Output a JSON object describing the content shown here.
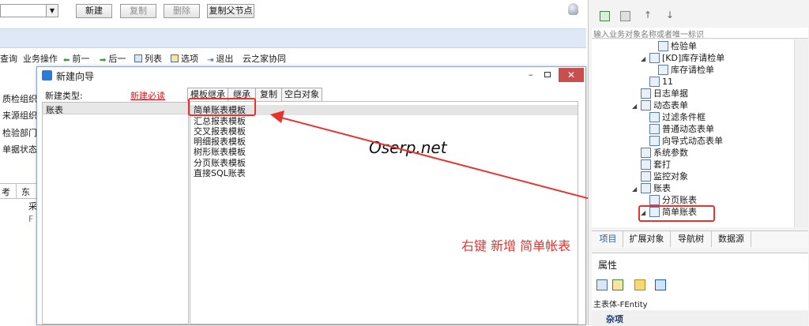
{
  "toolbar": {
    "new_label": "新建",
    "copy_label": "复制",
    "delete_label": "删除",
    "copy_parent_label": "复制父节点"
  },
  "menu": {
    "query": "查询",
    "biz_ops": "业务操作",
    "prev": "前一",
    "next": "后一",
    "list": "列表",
    "options": "选项",
    "exit": "退出",
    "cloud": "云之家协同"
  },
  "left_labels": [
    "质检组织",
    "来源组织",
    "检验部门",
    "单据状态"
  ],
  "left_grid": {
    "col1": "考",
    "col2": "东",
    "cell_a": "采",
    "cell_b": "F"
  },
  "dialog": {
    "title": "新建向导",
    "type_label": "新建类型:",
    "required_link": "新建必读",
    "type_items": [
      "账表"
    ],
    "tabs": [
      "模板继承",
      "继承",
      "复制",
      "空白对象"
    ],
    "templates": [
      "简单账表模板",
      "汇总报表模板",
      "交叉报表模板",
      "明细报表模板",
      "树形账表模板",
      "分页账表模板",
      "直接SQL账表"
    ]
  },
  "annotation": {
    "watermark": "Oserp.net",
    "note": "右键 新增 简单帐表"
  },
  "right_panel": {
    "search_placeholder": "输入业务对象名称或者唯一标识",
    "tree": [
      {
        "label": "检验单",
        "indent": 3,
        "arrow": ""
      },
      {
        "label": "[KD]库存请检单",
        "indent": 2,
        "arrow": "◢"
      },
      {
        "label": "库存请检单",
        "indent": 3,
        "arrow": ""
      },
      {
        "label": "11",
        "indent": 2,
        "arrow": ""
      },
      {
        "label": "日志单据",
        "indent": 1,
        "arrow": ""
      },
      {
        "label": "动态表单",
        "indent": 1,
        "arrow": "◢"
      },
      {
        "label": "过滤条件框",
        "indent": 2,
        "arrow": ""
      },
      {
        "label": "普通动态表单",
        "indent": 2,
        "arrow": ""
      },
      {
        "label": "向导式动态表单",
        "indent": 2,
        "arrow": ""
      },
      {
        "label": "系统参数",
        "indent": 1,
        "arrow": ""
      },
      {
        "label": "套打",
        "indent": 1,
        "arrow": ""
      },
      {
        "label": "监控对象",
        "indent": 1,
        "arrow": ""
      },
      {
        "label": "账表",
        "indent": 1,
        "arrow": "◢"
      },
      {
        "label": "分页账表",
        "indent": 2,
        "arrow": ""
      },
      {
        "label": "简单账表",
        "indent": 2,
        "arrow": "◢"
      }
    ],
    "bottom_tabs": [
      "项目",
      "扩展对象",
      "导航树",
      "数据源"
    ],
    "props_title": "属性",
    "entity_label": "主表体-FEntity",
    "misc_label": "杂项"
  },
  "colors": {
    "accent_red": "#e8322e",
    "dialog_blue": "#2b7bd8",
    "close_red": "#c94f4f",
    "link_red": "#d9141a"
  }
}
